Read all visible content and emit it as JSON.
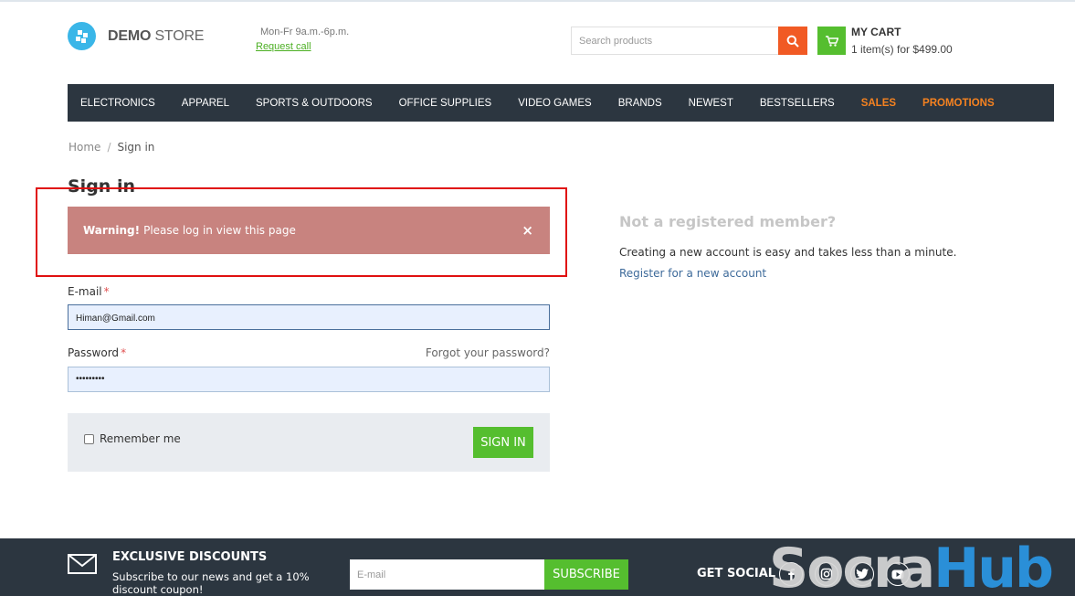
{
  "header": {
    "logo_bold": "DEMO",
    "logo_rest": " STORE",
    "hours": "Mon-Fr 9a.m.-6p.m.",
    "request_call": "Request call",
    "search_placeholder": "Search products",
    "cart_title": "MY CART",
    "cart_summary": "1 item(s) for $499.00"
  },
  "nav": {
    "items": [
      "ELECTRONICS",
      "APPAREL",
      "SPORTS & OUTDOORS",
      "OFFICE SUPPLIES",
      "VIDEO GAMES",
      "BRANDS",
      "NEWEST",
      "BESTSELLERS",
      "SALES",
      "PROMOTIONS"
    ]
  },
  "breadcrumb": {
    "home": "Home",
    "separator": "/",
    "current": "Sign in"
  },
  "page_title": "Sign in",
  "warning": {
    "bold": "Warning!",
    "text": "Please log in view this page",
    "close": "×"
  },
  "form": {
    "email_label": "E-mail",
    "required_mark": "*",
    "email_value": "Himan@Gmail.com",
    "password_label": "Password",
    "password_value": "•••••••••",
    "forgot": "Forgot your password?",
    "remember": "Remember me",
    "sign_in": "SIGN IN"
  },
  "register": {
    "title": "Not a registered member?",
    "text": "Creating a new account is easy and takes less than a minute.",
    "link": "Register for a new account"
  },
  "footer": {
    "discount_title": "EXCLUSIVE DISCOUNTS",
    "discount_text": "Subscribe to our news and get a 10% discount coupon!",
    "email_placeholder": "E-mail",
    "subscribe": "SUBSCRIBE",
    "social_title": "GET SOCIAL",
    "social_icons": [
      "facebook-icon",
      "instagram-icon",
      "twitter-icon",
      "youtube-icon"
    ]
  },
  "watermark": {
    "part1": "Socra",
    "part2": "Hub"
  },
  "colors": {
    "nav_bg": "#2c3640",
    "accent_green": "#55be2f",
    "accent_orange": "#f58220",
    "search_btn": "#f15a24",
    "warning_bg": "#c8837f",
    "highlight_frame": "#e01010"
  }
}
